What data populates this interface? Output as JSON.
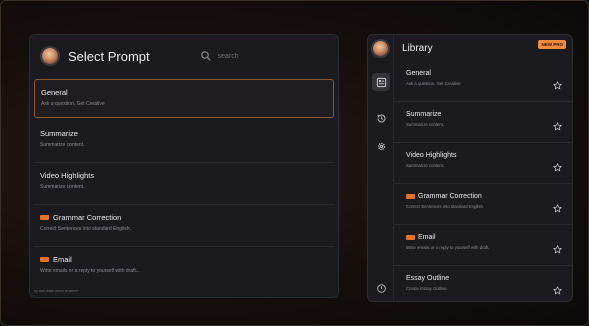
{
  "select_prompt": {
    "title": "Select Prompt",
    "search_placeholder": "search",
    "items": [
      {
        "title": "General",
        "desc": "Ask a question, Get Creative",
        "badge": false
      },
      {
        "title": "Summarize",
        "desc": "Summarize content.",
        "badge": false
      },
      {
        "title": "Video Highlights",
        "desc": "Summarize content.",
        "badge": false
      },
      {
        "title": "Grammar Correction",
        "desc": "Correct Sentences into standard English.",
        "badge": true
      },
      {
        "title": "Email",
        "desc": "Write emails or a reply to yourself with draft...",
        "badge": true
      }
    ],
    "footer": "up and down arrow to select"
  },
  "library": {
    "title": "Library",
    "pro_badge": "NEW PRO",
    "items": [
      {
        "title": "General",
        "desc": "Ask a question, Get Creative",
        "badge": false
      },
      {
        "title": "Summarize",
        "desc": "Summarize content.",
        "badge": false
      },
      {
        "title": "Video Highlights",
        "desc": "Summarize content.",
        "badge": false
      },
      {
        "title": "Grammar Correction",
        "desc": "Correct Sentences into standard English.",
        "badge": true
      },
      {
        "title": "Email",
        "desc": "Write emails or a reply to yourself with draft.",
        "badge": true
      },
      {
        "title": "Essay Outline",
        "desc": "Create Essay Outline.",
        "badge": false
      }
    ]
  },
  "colors": {
    "accent": "#f08a3c",
    "selected_border": "#8a5a2e",
    "panel_bg": "#1b1b1f"
  }
}
